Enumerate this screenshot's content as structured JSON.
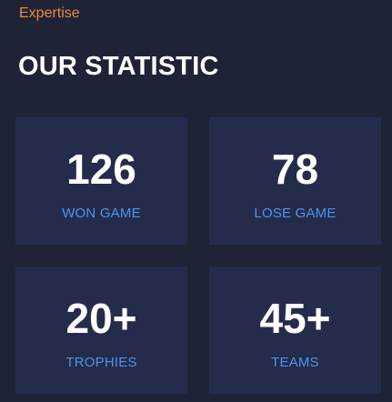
{
  "header": {
    "eyebrow": "Expertise",
    "title": "OUR STATISTIC"
  },
  "stats": [
    {
      "value": "126",
      "label": "WON GAME"
    },
    {
      "value": "78",
      "label": "LOSE GAME"
    },
    {
      "value": "20+",
      "label": "TROPHIES"
    },
    {
      "value": "45+",
      "label": "TEAMS"
    }
  ],
  "colors": {
    "background": "#1e2336",
    "card": "#252c4b",
    "accent_orange": "#f0893a",
    "accent_blue": "#4e93ec",
    "text": "#ffffff"
  }
}
